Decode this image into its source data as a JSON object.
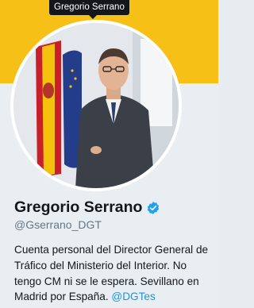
{
  "tooltip": {
    "text": "Gregorio Serrano"
  },
  "profile": {
    "name": "Gregorio Serrano",
    "handle": "@Gserrano_DGT",
    "verified": true,
    "bio_text": "Cuenta personal del Director General de Tráfico del Ministerio del Interior. No tengo CM ni se le espera. Sevillano en Madrid por España.",
    "bio_mention": "@DGTes"
  },
  "colors": {
    "banner": "#f7c016",
    "link": "#1b95e0",
    "verified_badge": "#1da1f2"
  },
  "icons": {
    "verified": "verified-badge-icon"
  }
}
